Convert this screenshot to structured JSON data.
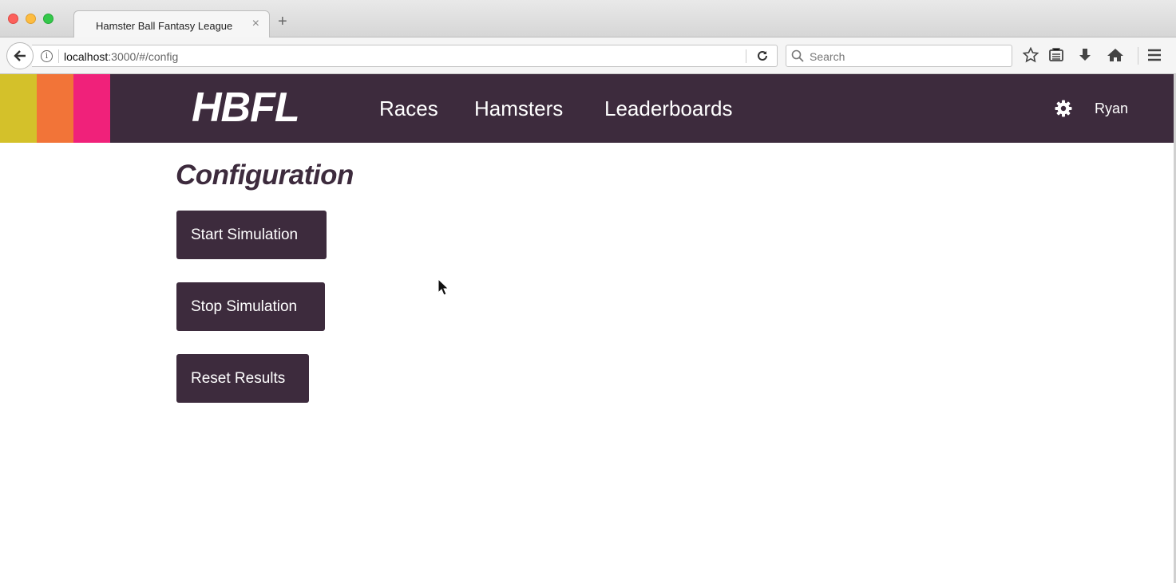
{
  "browser": {
    "tab_title": "Hamster Ball Fantasy League",
    "tab_close": "×",
    "new_tab": "+",
    "url_host": "localhost",
    "url_path": ":3000/#/config",
    "search_placeholder": "Search",
    "icons": [
      "back-arrow-icon",
      "info-icon",
      "reload-icon",
      "search-icon",
      "star-icon",
      "reading-list-icon",
      "download-icon",
      "home-icon",
      "hamburger-menu-icon"
    ]
  },
  "header": {
    "logo": "HBFL",
    "stripe_colors": [
      "#d4c12a",
      "#f27438",
      "#f0217a"
    ],
    "background": "#3d2b3d",
    "nav": [
      {
        "label": "Races"
      },
      {
        "label": "Hamsters"
      },
      {
        "label": "Leaderboards"
      }
    ],
    "user": "Ryan",
    "settings_icon": "gear-icon"
  },
  "main": {
    "title": "Configuration",
    "buttons": [
      {
        "label": "Start Simulation"
      },
      {
        "label": "Stop Simulation"
      },
      {
        "label": "Reset Results"
      }
    ]
  }
}
